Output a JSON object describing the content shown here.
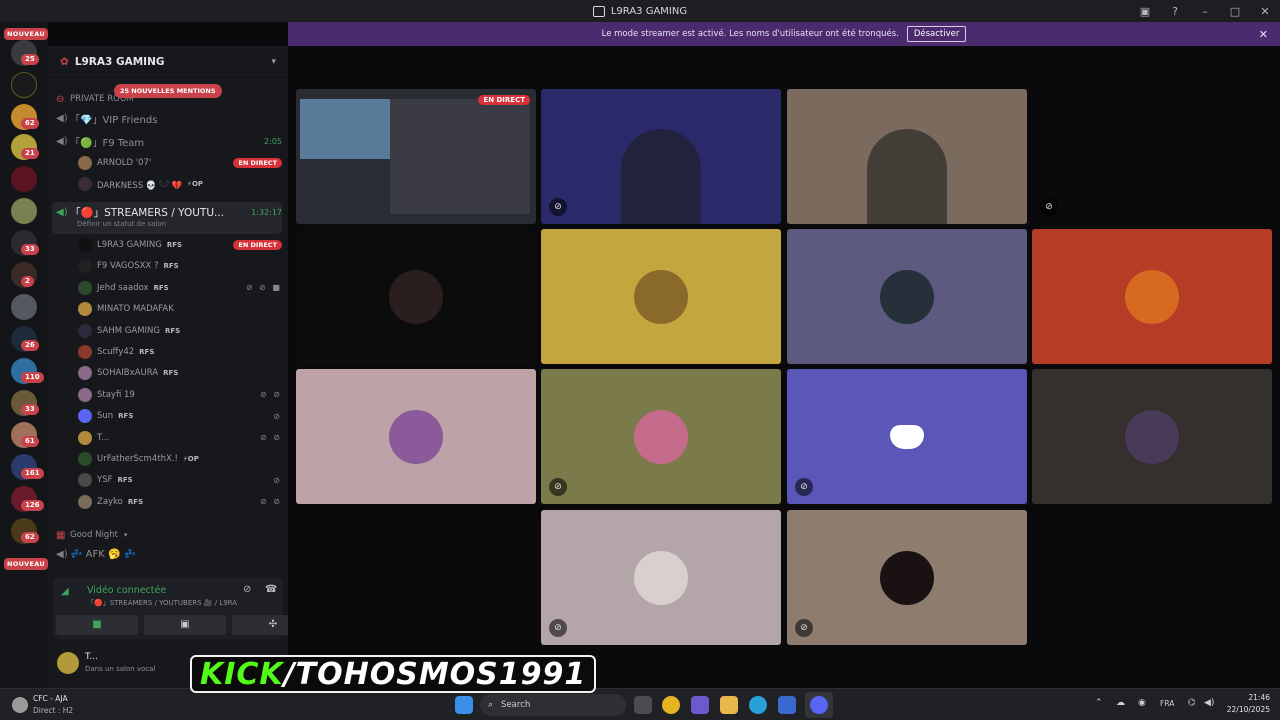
{
  "window": {
    "title": "L9RA3 GAMING"
  },
  "rail": {
    "new_badge": "NOUVEAU",
    "badges": [
      "25",
      "62",
      "21",
      "33",
      "2",
      "26",
      "110",
      "33",
      "61",
      "161",
      "126",
      "62"
    ]
  },
  "server": {
    "name": "L9RA3 GAMING"
  },
  "mentions_badge": "25 NOUVELLES MENTIONS",
  "channels": [
    {
      "label": "PRIVATE ROOM",
      "time": ""
    },
    {
      "label": "「💎」VIP Friends",
      "time": ""
    },
    {
      "label": "「🟢」F9 Team",
      "time": "2:05"
    }
  ],
  "f9_users": [
    {
      "name": "ARNOLD '07'",
      "tag": "",
      "live": "EN DIRECT"
    },
    {
      "name": "DARKNESS 💀 𓆩𓆪 💔",
      "tag": "⚡OP",
      "live": ""
    }
  ],
  "streamers_channel": {
    "label": "「🔴」STREAMERS / YOUTU...",
    "time": "1:32:17",
    "status_hint": "Définir un statut de salon"
  },
  "streamer_users": [
    {
      "name": "L9RA3 GAMING",
      "tag": "RFS",
      "live": "EN DIRECT",
      "mute": ""
    },
    {
      "name": "F9 VAGOSXX ?",
      "tag": "RFS",
      "live": "",
      "mute": ""
    },
    {
      "name": "Jehd saadox",
      "tag": "RFS",
      "live": "",
      "mute": "⊘ ⊘ ■"
    },
    {
      "name": "MINATO MADAFAK",
      "tag": "",
      "live": "",
      "mute": ""
    },
    {
      "name": "SAHM GAMING",
      "tag": "RFS",
      "live": "",
      "mute": ""
    },
    {
      "name": "Scuffy42",
      "tag": "RFS",
      "live": "",
      "mute": ""
    },
    {
      "name": "SOHAIBxAURA",
      "tag": "RFS",
      "live": "",
      "mute": ""
    },
    {
      "name": "Stayfi 19",
      "tag": "",
      "live": "",
      "mute": "⊘ ⊘"
    },
    {
      "name": "Sun",
      "tag": "RFS",
      "live": "",
      "mute": "⊘"
    },
    {
      "name": "T...",
      "tag": "",
      "live": "",
      "mute": "⊘ ⊘"
    },
    {
      "name": "UrFatherScm4thX.!",
      "tag": "⚡OP",
      "live": "",
      "mute": ""
    },
    {
      "name": "YSF",
      "tag": "RFS",
      "live": "",
      "mute": "⊘"
    },
    {
      "name": "Zayko",
      "tag": "RFS",
      "live": "",
      "mute": "⊘ ⊘"
    }
  ],
  "other_channels": [
    {
      "label": "Good Night"
    },
    {
      "label": "💤 AFK 🥱 💤"
    }
  ],
  "voice": {
    "status": "Vidéo connectée",
    "channel": "「🔴」STREAMERS / YOUTUBERS 🎥 / L9RA3 G..."
  },
  "user": {
    "name": "T...",
    "status": "Dans un salon vocal"
  },
  "banner": {
    "text": "Le mode streamer est activé. Les noms d'utilisateur ont été tronqués.",
    "button": "Désactiver"
  },
  "tiles": [
    {
      "kind": "screen",
      "bg": "#2a2c33",
      "live": "EN DIRECT",
      "mic": ""
    },
    {
      "kind": "cam",
      "bg": "#2a2a6a",
      "live": "",
      "mic": "⊘"
    },
    {
      "kind": "cam",
      "bg": "#7a6b5e",
      "live": "",
      "mic": ""
    },
    {
      "kind": "empty",
      "bg": "#0a0a0c",
      "live": "",
      "mic": "⊘"
    },
    {
      "kind": "avatar",
      "bg": "#0c0c0d",
      "ava": "#2a1e1e",
      "live": "",
      "mic": ""
    },
    {
      "kind": "avatar",
      "bg": "#c4a63e",
      "ava": "#8a6a2a",
      "live": "",
      "mic": ""
    },
    {
      "kind": "avatar",
      "bg": "#5d5a7f",
      "ava": "#25303b",
      "live": "",
      "mic": ""
    },
    {
      "kind": "avatar",
      "bg": "#b63c26",
      "ava": "#d66a22",
      "live": "",
      "mic": ""
    },
    {
      "kind": "avatar",
      "bg": "#bda2a8",
      "ava": "#8a5a9a",
      "live": "",
      "mic": ""
    },
    {
      "kind": "avatar",
      "bg": "#7a7a4a",
      "ava": "#c46a8a",
      "live": "",
      "mic": "⊘"
    },
    {
      "kind": "discord",
      "bg": "#5a57b9",
      "ava": "",
      "live": "",
      "mic": "⊘"
    },
    {
      "kind": "avatar",
      "bg": "#34302e",
      "ava": "#4a3a5a",
      "live": "",
      "mic": ""
    },
    {
      "kind": "avatar",
      "bg": "#b3a5a8",
      "ava": "#d8cfcf",
      "live": "",
      "mic": "⊘"
    },
    {
      "kind": "avatar",
      "bg": "#8e7c6f",
      "ava": "#1a1212",
      "live": "",
      "mic": "⊘"
    }
  ],
  "overlay": {
    "kick": "KICK",
    "handle": "/TOHOSMOS1991"
  },
  "taskbar": {
    "weather_title": "CFC - AJA",
    "weather_sub": "Direct : H2",
    "search": "Search",
    "lang": "FRA",
    "time": "21:46",
    "date": "22/10/2025"
  }
}
